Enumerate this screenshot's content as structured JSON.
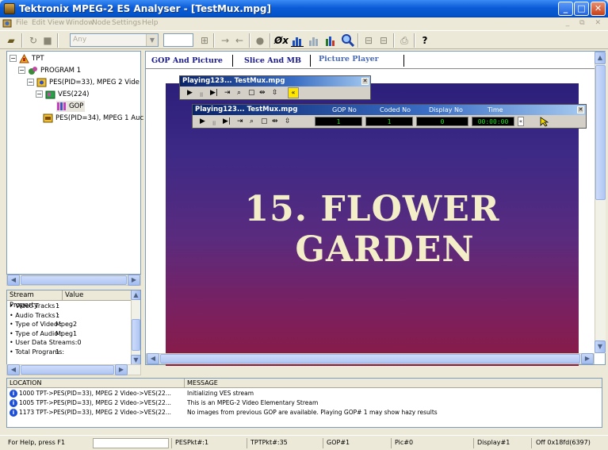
{
  "window": {
    "title": "Tektronix MPEG-2 ES Analyser - [TestMux.mpg]"
  },
  "menu": [
    "File",
    "Edit",
    "View",
    "Window",
    "Node",
    "Settings",
    "Help"
  ],
  "toolbar": {
    "combo_value": "Any",
    "number_value": ""
  },
  "tree": {
    "root": "TPT",
    "program": "PROGRAM 1",
    "pes_video": "PES(PID=33), MPEG 2 Vide",
    "ves": "VES(224)",
    "gop": "GOP",
    "pes_audio": "PES(PID=34), MPEG 1 Auc"
  },
  "properties": {
    "headers": [
      "Stream Property",
      "Value"
    ],
    "rows": [
      {
        "name": "Video Tracks :",
        "value": "1"
      },
      {
        "name": "Audio Tracks :",
        "value": "1"
      },
      {
        "name": "Type of Video :",
        "value": "Mpeg2"
      },
      {
        "name": "Type of Audio :",
        "value": "Mpeg1"
      },
      {
        "name": "User Data Streams:",
        "value": "0"
      },
      {
        "name": "Total Programs:",
        "value": "1"
      }
    ]
  },
  "tabs": [
    "GOP And Picture",
    "Slice And MB",
    "Picture Player"
  ],
  "video": {
    "line1": "15. FLOWER",
    "line2": "GARDEN"
  },
  "player1": {
    "title": "Playing123... TestMux.mpg"
  },
  "player2": {
    "title": "Playing123... TestMux.mpg",
    "labels": {
      "gop": "GOP No",
      "coded": "Coded No",
      "display": "Display No",
      "time": "Time"
    },
    "values": {
      "gop": "1",
      "coded": "1",
      "display": "0",
      "time": "00:00:00"
    }
  },
  "log": {
    "headers": [
      "LOCATION",
      "MESSAGE"
    ],
    "rows": [
      {
        "code": "1000",
        "location": "TPT->PES(PID=33), MPEG 2 Video->VES(22...",
        "message": "Initializing VES stream"
      },
      {
        "code": "1005",
        "location": "TPT->PES(PID=33), MPEG 2 Video->VES(22...",
        "message": "This is an MPEG-2 Video Elementary Stream"
      },
      {
        "code": "1173",
        "location": "TPT->PES(PID=33), MPEG 2 Video->VES(22...",
        "message": "No images from previous GOP are available. Playing GOP# 1 may show hazy results"
      }
    ]
  },
  "status": {
    "help": "For Help, press F1",
    "pespkt": "PESPkt#:1",
    "tptpkt": "TPTPkt#:35",
    "gop": "GOP#1",
    "pic": "Pic#0",
    "display": "Display#1",
    "offset": "Off 0x18fd(6397)"
  },
  "colors": {
    "title_bar": "#0a5bd6",
    "video_top": "#2b1f7a",
    "video_bottom": "#8a1b44",
    "lcd_text": "#2bdc2b"
  }
}
